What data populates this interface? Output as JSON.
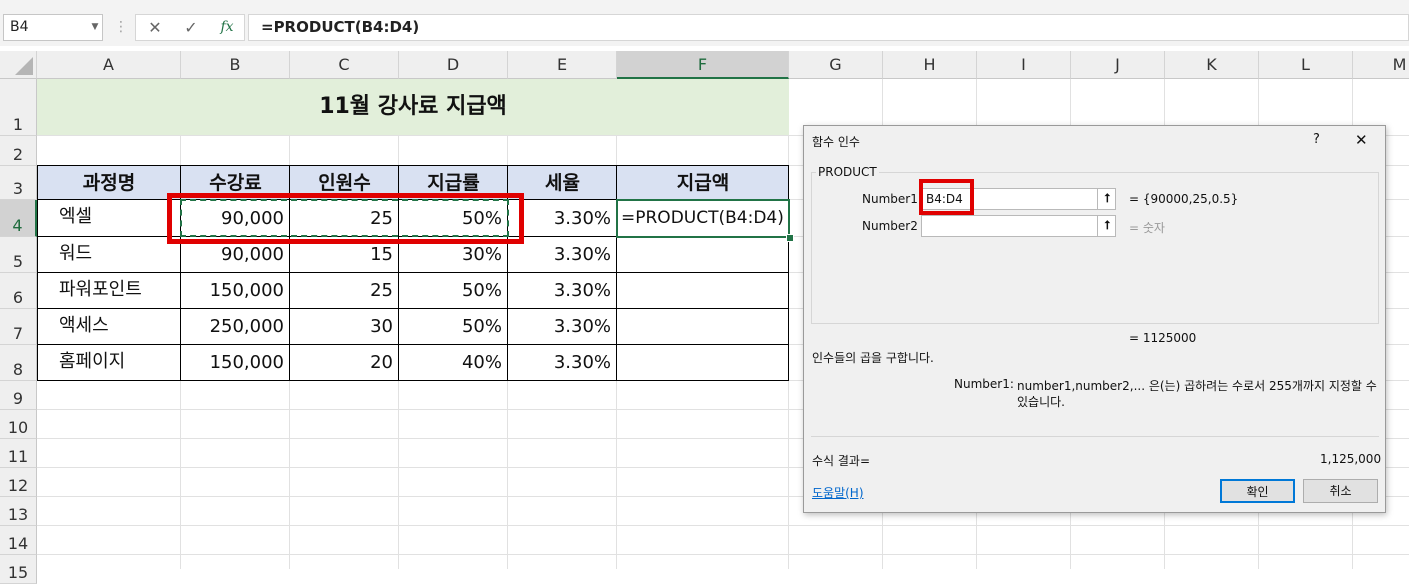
{
  "formula_bar": {
    "name_box": "B4",
    "cancel_icon": "✕",
    "enter_icon": "✓",
    "fx_label": "fx",
    "formula": "=PRODUCT(B4:D4)"
  },
  "columns": [
    "A",
    "B",
    "C",
    "D",
    "E",
    "F",
    "G",
    "H",
    "I",
    "J",
    "K",
    "L",
    "M"
  ],
  "rows": [
    "1",
    "2",
    "3",
    "4",
    "5",
    "6",
    "7",
    "8",
    "9",
    "10",
    "11",
    "12",
    "13",
    "14",
    "15"
  ],
  "sheet": {
    "title": "11월 강사료 지급액",
    "headers": [
      "과정명",
      "수강료",
      "인원수",
      "지급률",
      "세율",
      "지급액"
    ],
    "data": [
      {
        "name": "엑셀",
        "fee": "90,000",
        "count": "25",
        "rate": "50%",
        "tax": "3.30%",
        "amount": "=PRODUCT(B4:D4)"
      },
      {
        "name": "워드",
        "fee": "90,000",
        "count": "15",
        "rate": "30%",
        "tax": "3.30%",
        "amount": ""
      },
      {
        "name": "파워포인트",
        "fee": "150,000",
        "count": "25",
        "rate": "50%",
        "tax": "3.30%",
        "amount": ""
      },
      {
        "name": "액세스",
        "fee": "250,000",
        "count": "30",
        "rate": "50%",
        "tax": "3.30%",
        "amount": ""
      },
      {
        "name": "홈페이지",
        "fee": "150,000",
        "count": "20",
        "rate": "40%",
        "tax": "3.30%",
        "amount": ""
      }
    ]
  },
  "dialog": {
    "title": "함수 인수",
    "help_icon": "?",
    "close_icon": "✕",
    "function_name": "PRODUCT",
    "arg1_label": "Number1",
    "arg1_value": "B4:D4",
    "arg1_result": "= {90000,25,0.5}",
    "arg2_label": "Number2",
    "arg2_value": "",
    "arg2_result": "= 숫자",
    "formula_result_inline": "= 1125000",
    "description": "인수들의 곱을 구합니다.",
    "arg_help_label": "Number1:",
    "arg_help_text_1": "number1,number2,... 은(는) 곱하려는 수로서 255개까지 지정할 수",
    "arg_help_text_2": "있습니다.",
    "result_label": "수식 결과=",
    "result_value": "1,125,000",
    "help_link": "도움말(H)",
    "ok_label": "확인",
    "cancel_label": "취소"
  },
  "colors": {
    "title_fill": "#e2efda",
    "header_fill": "#d9e1f2",
    "highlight_box": "#e00000",
    "excel_green": "#217346"
  }
}
